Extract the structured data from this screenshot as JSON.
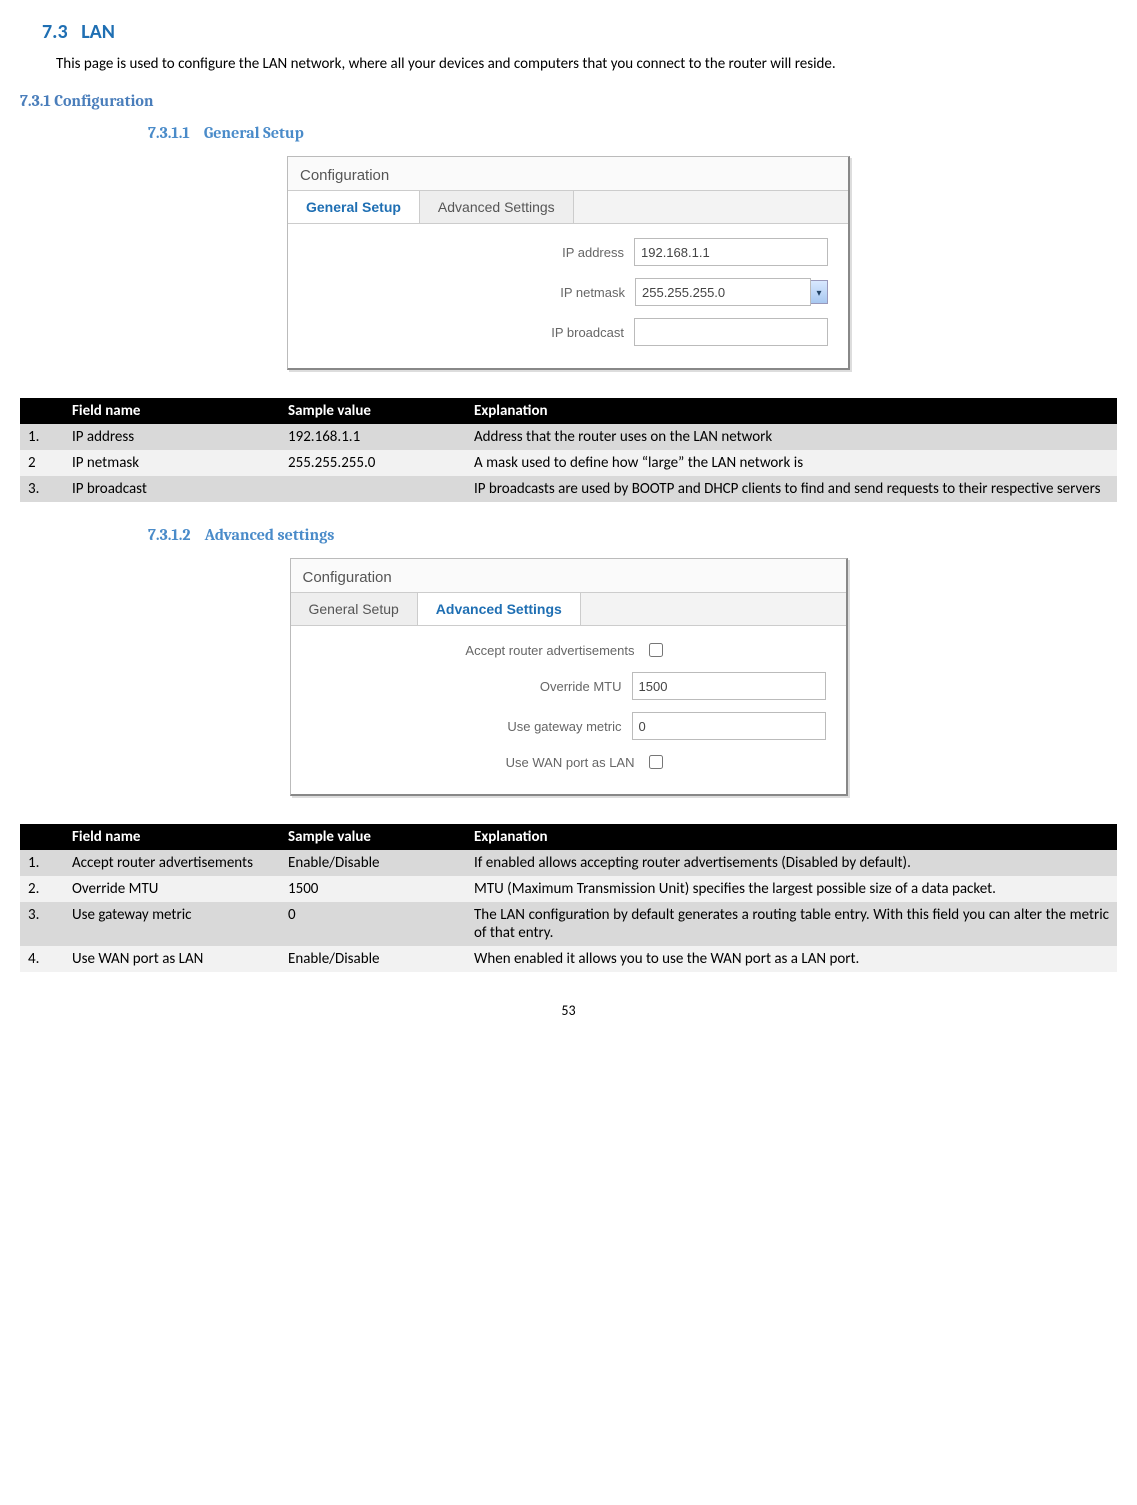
{
  "section_7_3_num": "7.3",
  "section_7_3_title": "LAN",
  "intro_text": "This page is used to configure the LAN network, where all your devices and computers that you connect to the router will reside.",
  "section_7_3_1": "7.3.1 Configuration",
  "section_7_3_1_1_num": "7.3.1.1",
  "section_7_3_1_1_title": "General Setup",
  "fig1": {
    "header": "Configuration",
    "tab_general": "General Setup",
    "tab_advanced": "Advanced Settings",
    "label_ip_address": "IP address",
    "value_ip_address": "192.168.1.1",
    "label_ip_netmask": "IP netmask",
    "value_ip_netmask": "255.255.255.0",
    "label_ip_broadcast": "IP broadcast",
    "value_ip_broadcast": ""
  },
  "table1": {
    "headers": {
      "num": "",
      "name": "Field name",
      "val": "Sample value",
      "exp": "Explanation"
    },
    "rows": [
      {
        "num": "1.",
        "name": "IP address",
        "val": "192.168.1.1",
        "exp": "Address that the router uses on the LAN network"
      },
      {
        "num": "2",
        "name": "IP netmask",
        "val": "255.255.255.0",
        "exp": "A mask used to define how “large” the LAN network is"
      },
      {
        "num": "3.",
        "name": "IP broadcast",
        "val": "",
        "exp": "IP broadcasts are used by BOOTP and DHCP clients to find and send requests to their respective servers"
      }
    ]
  },
  "section_7_3_1_2_num": "7.3.1.2",
  "section_7_3_1_2_title": "Advanced settings",
  "fig2": {
    "header": "Configuration",
    "tab_general": "General Setup",
    "tab_advanced": "Advanced Settings",
    "label_accept": "Accept router advertisements",
    "label_mtu": "Override MTU",
    "value_mtu": "1500",
    "label_metric": "Use gateway metric",
    "value_metric": "0",
    "label_wanlan": "Use WAN port as LAN"
  },
  "table2": {
    "headers": {
      "num": "",
      "name": "Field name",
      "val": "Sample value",
      "exp": "Explanation"
    },
    "rows": [
      {
        "num": "1.",
        "name": "Accept router advertisements",
        "val": "Enable/Disable",
        "exp": "If enabled allows accepting router advertisements (Disabled by default)."
      },
      {
        "num": "2.",
        "name": "Override MTU",
        "val": "1500",
        "exp": "MTU (Maximum Transmission Unit) specifies the largest possible size of a data packet."
      },
      {
        "num": "3.",
        "name": "Use gateway metric",
        "val": "0",
        "exp": "The LAN configuration by default generates a routing table entry. With this field you can alter the metric of that entry."
      },
      {
        "num": "4.",
        "name": "Use WAN port as LAN",
        "val": "Enable/Disable",
        "exp": "When enabled it allows you to use the WAN port as a LAN port."
      }
    ]
  },
  "page_number": "53"
}
